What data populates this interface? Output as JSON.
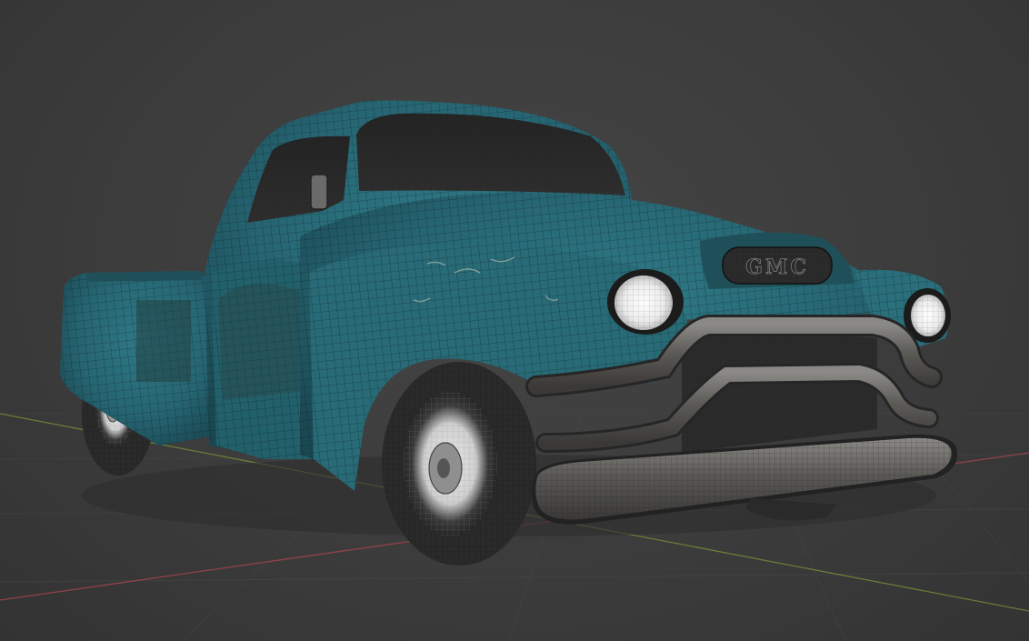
{
  "viewport": {
    "background_color": "#3c3c3c",
    "grid_line_color": "#4a4a4a",
    "x_axis_color": "#b5484f",
    "y_axis_color": "#7e9b3a"
  },
  "model": {
    "body_color": "#2b6c78",
    "body_dark_color": "#1d4e58",
    "rust_color": "#2a3b3c",
    "chrome_color": "#5a5a58",
    "headlight_color": "#f4f4f4",
    "grille_badge": "GMC"
  }
}
